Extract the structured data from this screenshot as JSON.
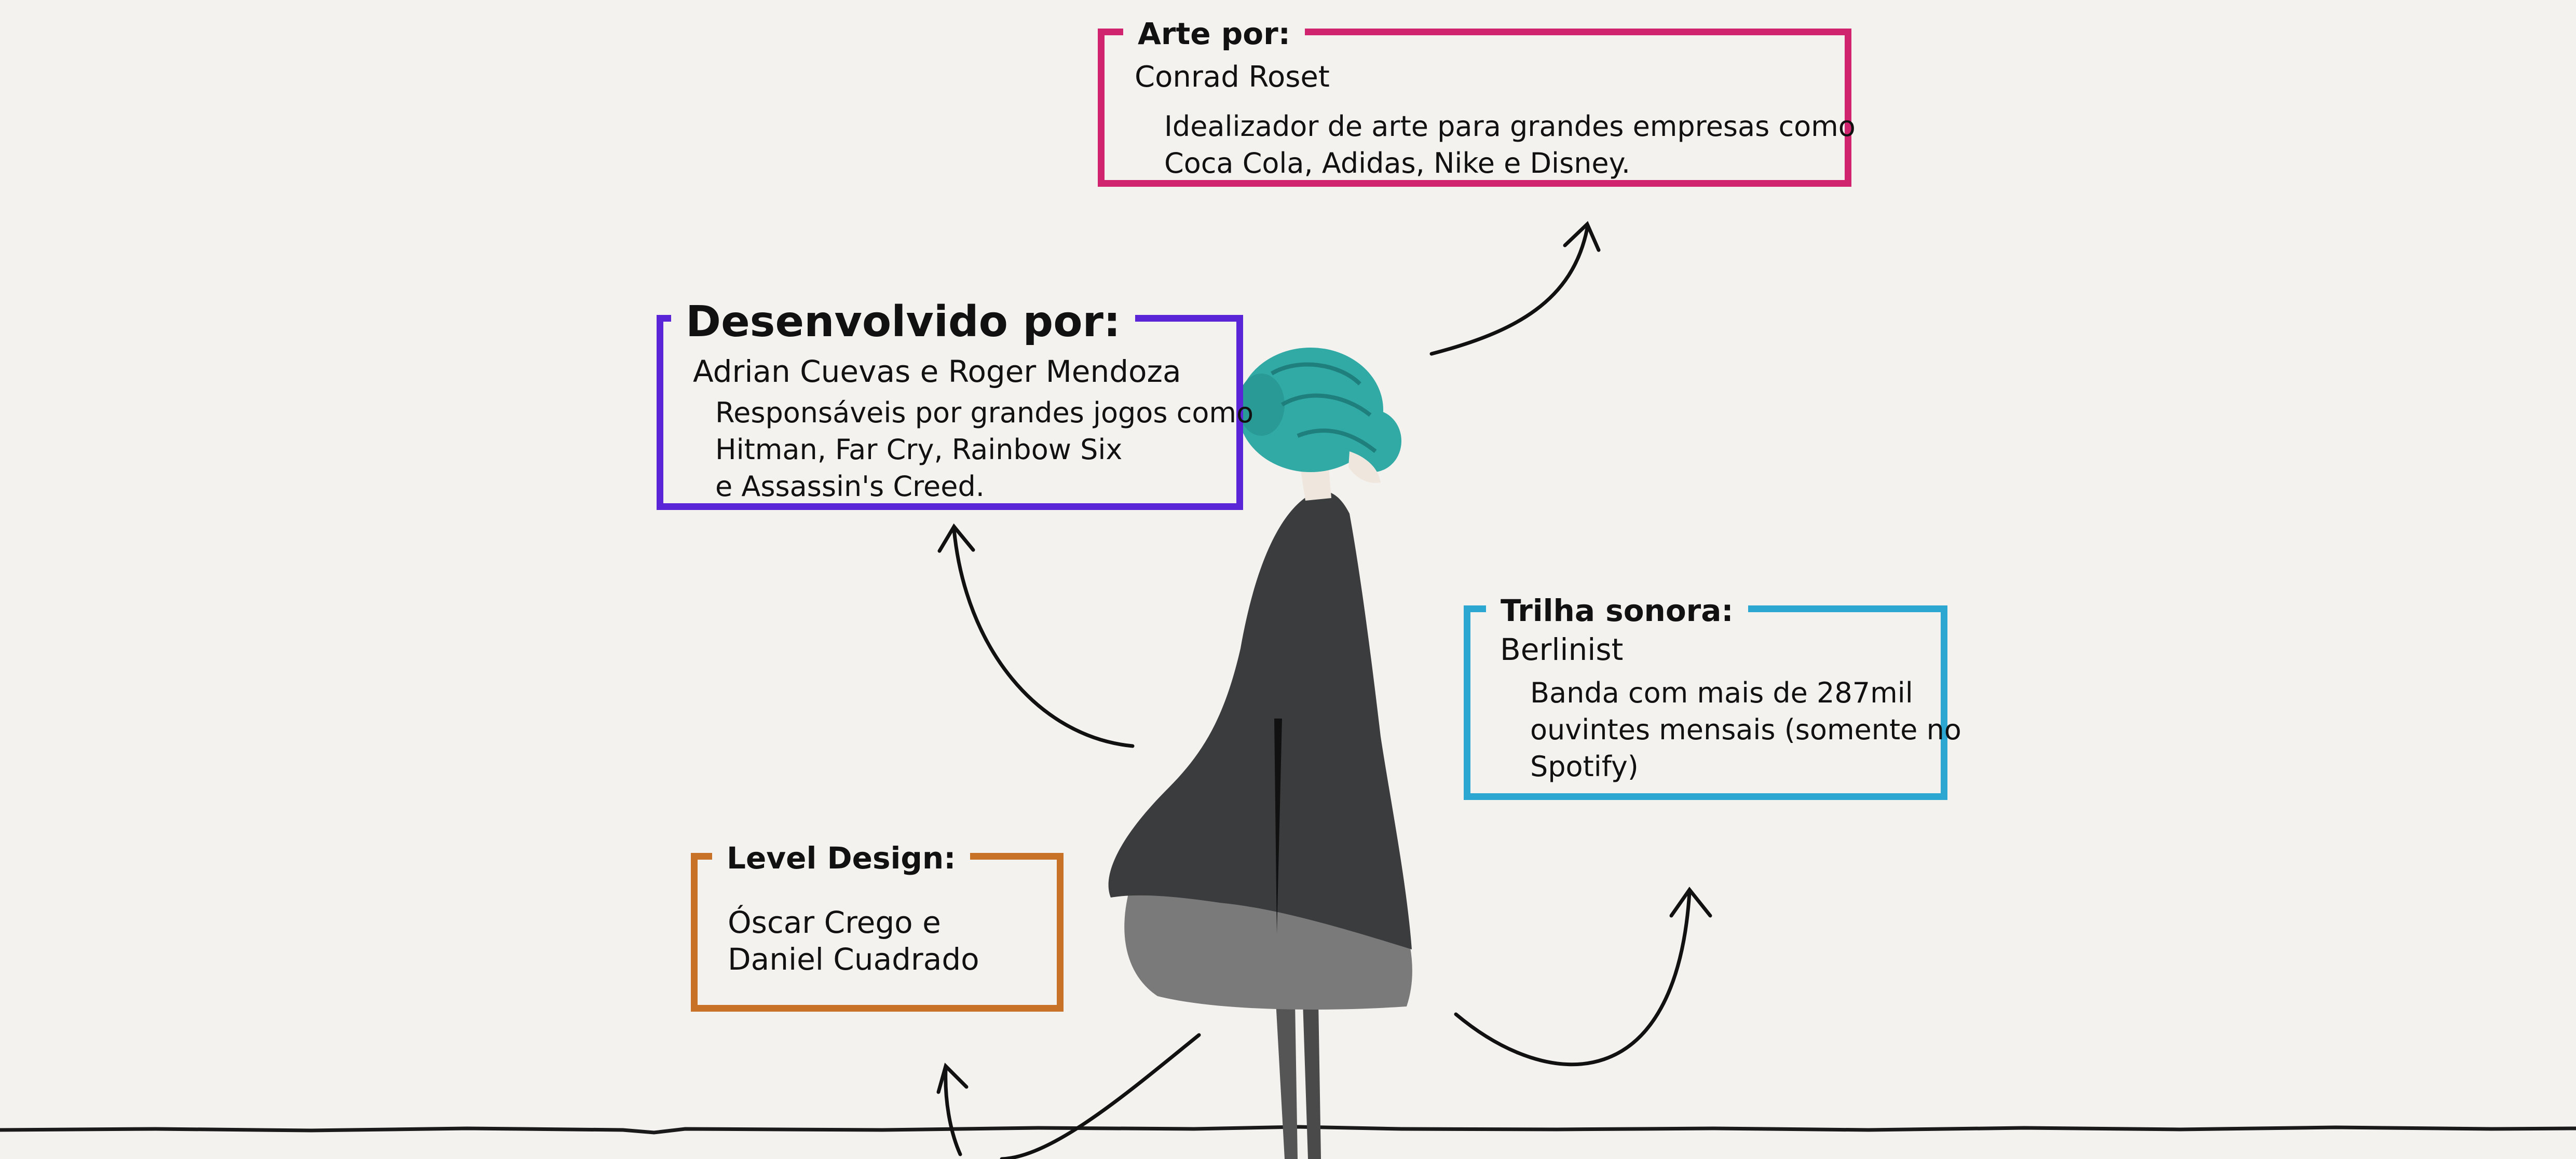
{
  "cards": {
    "art": {
      "title": "Arte por:",
      "name": "Conrad Roset",
      "body": [
        "Idealizador de arte para grandes empresas como",
        "Coca Cola, Adidas, Nike e Disney."
      ],
      "color": "#d1246f"
    },
    "dev": {
      "title": "Desenvolvido por:",
      "name": "Adrian Cuevas e Roger Mendoza",
      "body": [
        "Responsáveis por grandes jogos como",
        "Hitman, Far Cry, Rainbow Six",
        "e Assassin's Creed."
      ],
      "color": "#5a25d6"
    },
    "trilha": {
      "title": "Trilha sonora:",
      "name": "Berlinist",
      "body": [
        "Banda com mais de 287mil",
        "ouvintes mensais (somente no",
        "Spotify)"
      ],
      "color": "#2ba7d1"
    },
    "level": {
      "title": "Level Design:",
      "body": [
        "Óscar Crego e",
        "Daniel Cuadrado"
      ],
      "color": "#c87228"
    }
  },
  "illustration": {
    "subject": "girl-figure",
    "hair_color": "#31aaa6",
    "coat_color": "#3a3c3e",
    "skirt_color": "#7a7a7a"
  },
  "background_color": "#f4f2ee"
}
